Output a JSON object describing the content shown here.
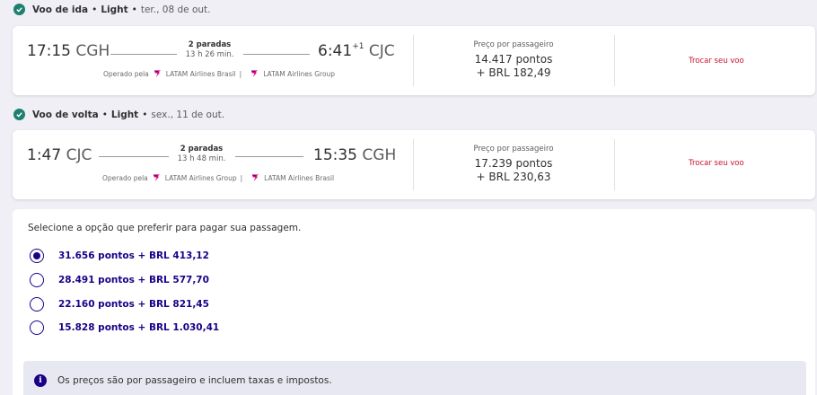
{
  "outbound": {
    "header_title": "Voo de ida",
    "fare": "Light",
    "date": "ter., 08 de out.",
    "dep_time": "17:15",
    "dep_airport": "CGH",
    "arr_time": "6:41",
    "arr_day_offset": "+1",
    "arr_airport": "CJC",
    "stops": "2 paradas",
    "duration": "13 h 26 min.",
    "operated_prefix": "Operado pela",
    "carrier_1": "LATAM Airlines Brasil",
    "carrier_2": "LATAM Airlines Group",
    "price_label": "Preço por passageiro",
    "price_points": "14.417 pontos",
    "price_brl": "+ BRL 182,49",
    "swap_label": "Trocar seu voo"
  },
  "inbound": {
    "header_title": "Voo de volta",
    "fare": "Light",
    "date": "sex., 11 de out.",
    "dep_time": "1:47",
    "dep_airport": "CJC",
    "arr_time": "15:35",
    "arr_airport": "CGH",
    "stops": "2 paradas",
    "duration": "13 h 48 min.",
    "operated_prefix": "Operado pela",
    "carrier_1": "LATAM Airlines Group",
    "carrier_2": "LATAM Airlines Brasil",
    "price_label": "Preço por passageiro",
    "price_points": "17.239 pontos",
    "price_brl": "+ BRL 230,63",
    "swap_label": "Trocar seu voo"
  },
  "payment": {
    "title": "Selecione a opção que preferir para pagar sua passagem.",
    "selected_index": 0,
    "options": [
      "31.656 pontos + BRL 413,12",
      "28.491 pontos + BRL 577,70",
      "22.160 pontos + BRL 821,45",
      "15.828 pontos + BRL 1.030,41"
    ],
    "info_text": "Os preços são por passageiro e incluem taxas e impostos."
  },
  "colors": {
    "brand": "#1b0088",
    "check": "#1d7f6e",
    "link": "#c8102e",
    "logo": "#e3007d"
  },
  "icons": [
    "check-icon",
    "latam-logo-icon",
    "info-icon",
    "radio-icon"
  ]
}
